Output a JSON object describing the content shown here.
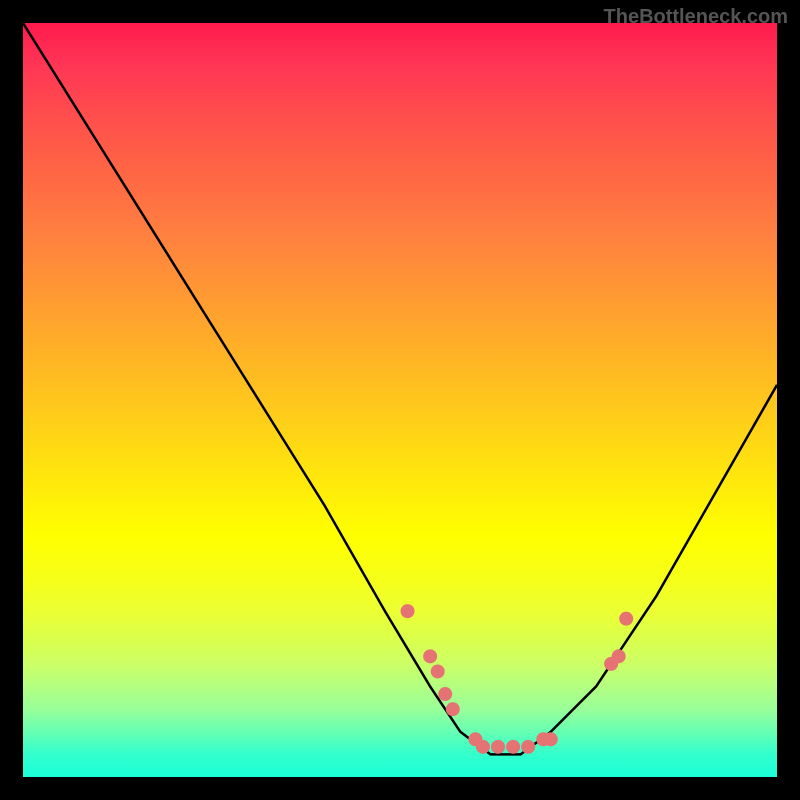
{
  "watermark": "TheBottleneck.com",
  "chart_data": {
    "type": "line",
    "title": "",
    "xlabel": "",
    "ylabel": "",
    "xlim": [
      0,
      100
    ],
    "ylim": [
      0,
      100
    ],
    "curve": {
      "description": "V-shaped bottleneck curve with minimum near x=63",
      "points": [
        {
          "x": 0,
          "y": 100
        },
        {
          "x": 10,
          "y": 84
        },
        {
          "x": 20,
          "y": 68
        },
        {
          "x": 30,
          "y": 52
        },
        {
          "x": 40,
          "y": 36
        },
        {
          "x": 48,
          "y": 22
        },
        {
          "x": 54,
          "y": 12
        },
        {
          "x": 58,
          "y": 6
        },
        {
          "x": 62,
          "y": 3
        },
        {
          "x": 66,
          "y": 3
        },
        {
          "x": 70,
          "y": 6
        },
        {
          "x": 76,
          "y": 12
        },
        {
          "x": 84,
          "y": 24
        },
        {
          "x": 92,
          "y": 38
        },
        {
          "x": 100,
          "y": 52
        }
      ]
    },
    "scatter_points": [
      {
        "x": 51,
        "y": 22
      },
      {
        "x": 54,
        "y": 16
      },
      {
        "x": 55,
        "y": 14
      },
      {
        "x": 56,
        "y": 11
      },
      {
        "x": 57,
        "y": 9
      },
      {
        "x": 60,
        "y": 5
      },
      {
        "x": 61,
        "y": 4
      },
      {
        "x": 63,
        "y": 4
      },
      {
        "x": 65,
        "y": 4
      },
      {
        "x": 67,
        "y": 4
      },
      {
        "x": 69,
        "y": 5
      },
      {
        "x": 70,
        "y": 5
      },
      {
        "x": 78,
        "y": 15
      },
      {
        "x": 79,
        "y": 16
      },
      {
        "x": 80,
        "y": 21
      }
    ]
  },
  "colors": {
    "background": "#000000",
    "curve": "#000000",
    "points": "#e67373",
    "gradient_top": "#ff1a4d",
    "gradient_bottom": "#1affd9"
  }
}
